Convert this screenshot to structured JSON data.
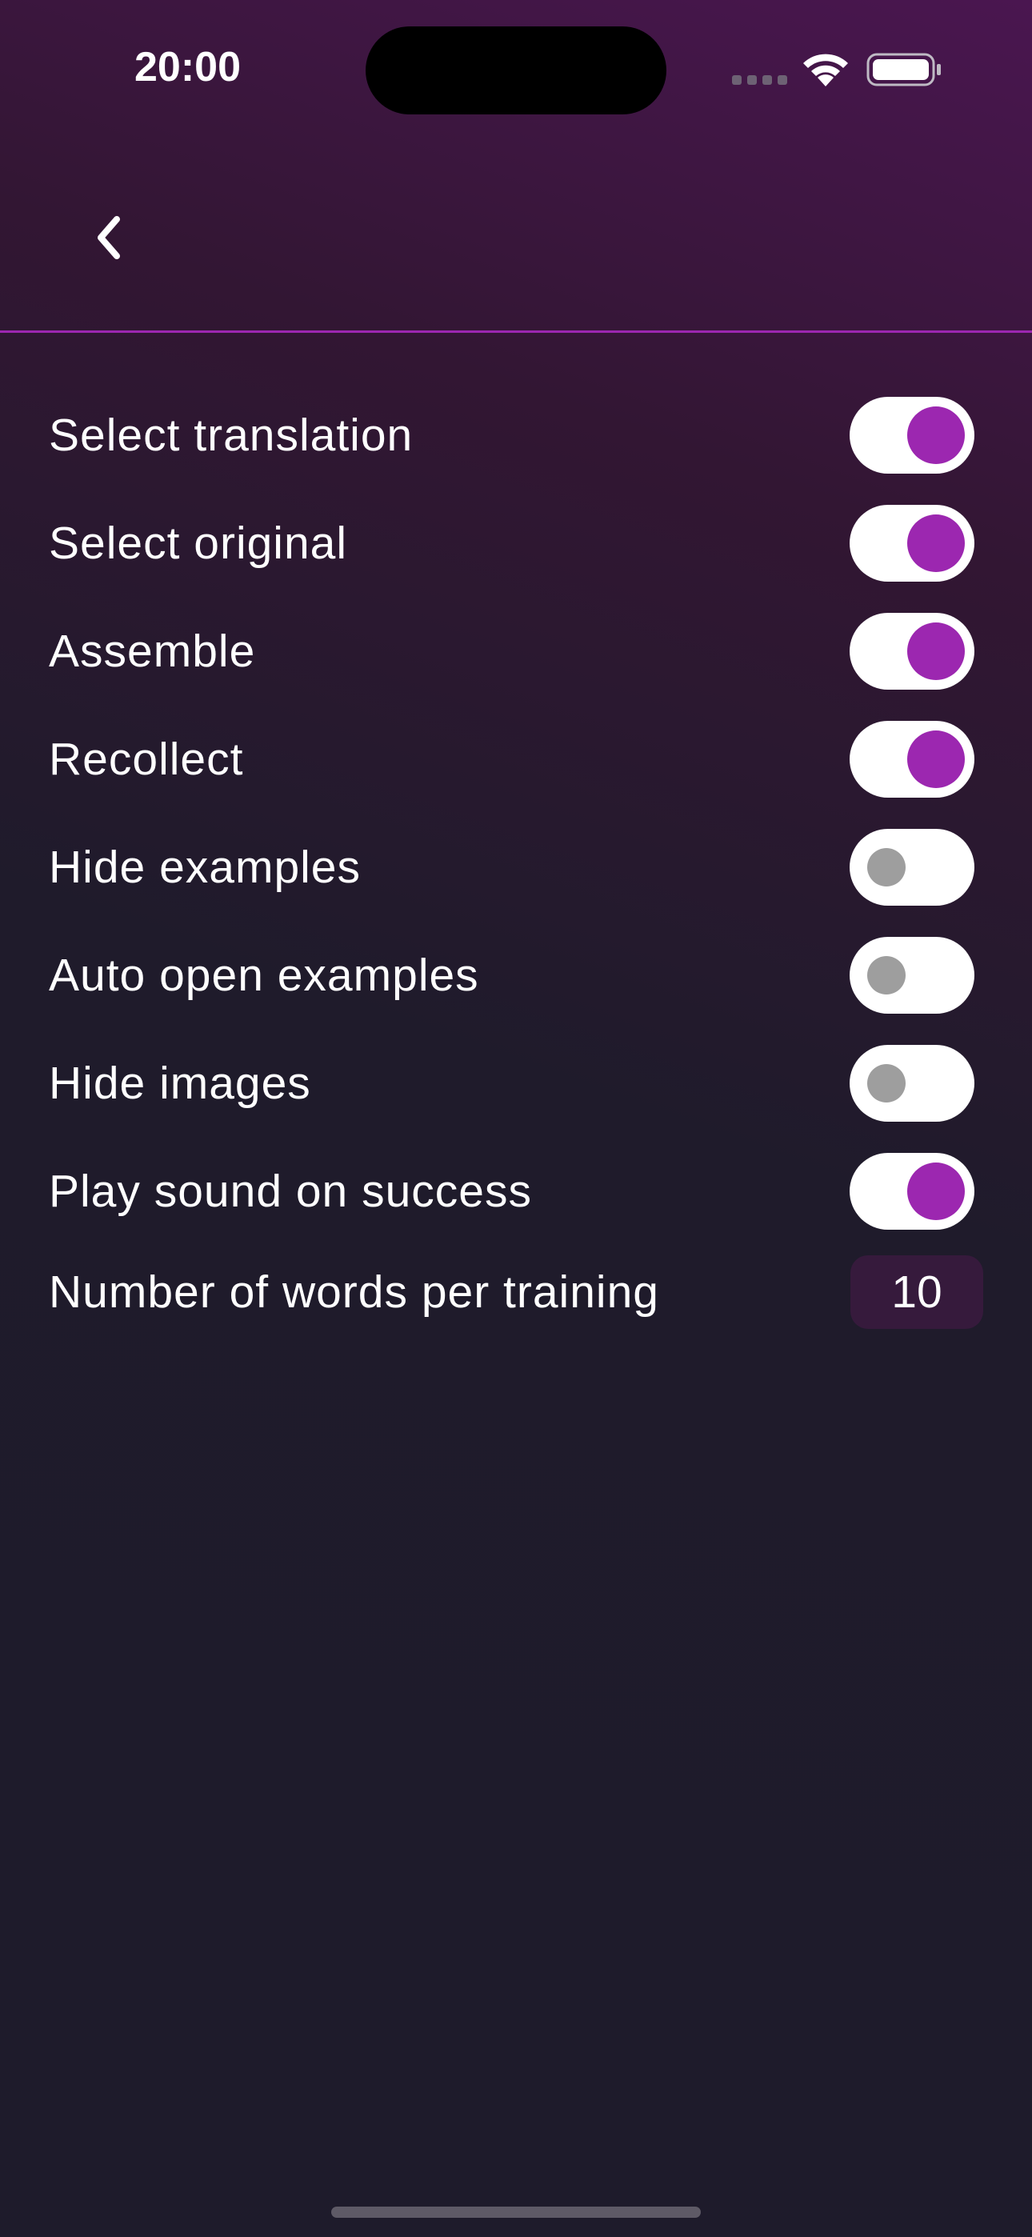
{
  "status_bar": {
    "time": "20:00"
  },
  "header": {
    "back_icon": "chevron-left-icon"
  },
  "settings": [
    {
      "label": "Select translation",
      "type": "toggle",
      "value": true
    },
    {
      "label": "Select original",
      "type": "toggle",
      "value": true
    },
    {
      "label": "Assemble",
      "type": "toggle",
      "value": true
    },
    {
      "label": "Recollect",
      "type": "toggle",
      "value": true
    },
    {
      "label": "Hide examples",
      "type": "toggle",
      "value": false
    },
    {
      "label": "Auto open examples",
      "type": "toggle",
      "value": false
    },
    {
      "label": "Hide images",
      "type": "toggle",
      "value": false
    },
    {
      "label": "Play sound on success",
      "type": "toggle",
      "value": true
    },
    {
      "label": "Number of words per training",
      "type": "number",
      "value": "10"
    }
  ],
  "colors": {
    "accent": "#9c27b0",
    "toggle_off_knob": "#9e9e9e",
    "toggle_track": "#ffffff",
    "background": "#1e1b2b"
  }
}
